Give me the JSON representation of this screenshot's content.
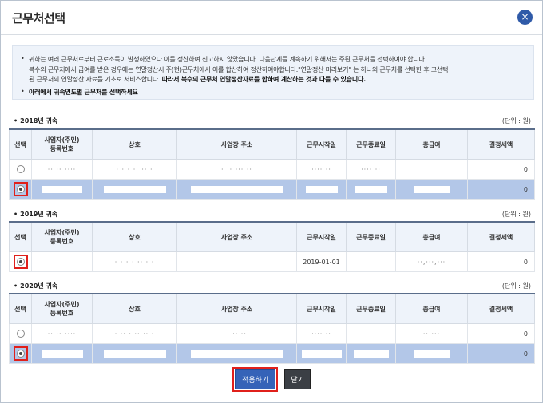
{
  "dialog": {
    "title": "근무처선택",
    "close_icon": "×"
  },
  "notice": {
    "line1": "귀하는 여러 근무처로부터 근로소득이 발생하였으나 이를 정산하여 신고하지 않았습니다. 다음단계를 계속하기 위해서는 주된 근무처를 선택하여야 합니다.",
    "line2": "복수의 근무처에서 급여를 받은 경우에는 연말정산시 주(현)근무처에서 이를 합산하여 정산하여야합니다.\"연말정산 미리보기\" 는 하나의 근무처를 선택한 후 그선택",
    "line3a": "된 근무처의 연말정산 자료를 기초로 서비스합니다.",
    "line3b": "따라서 복수의 근무처 연말정산자료를 합하여 계산하는 것과 다를 수 있습니다.",
    "line4": "아래에서 귀속연도별 근무처를 선택하세요"
  },
  "unit_label": "(단위 : 원)",
  "columns": [
    "선택",
    "사업자(주민)\n등록번호",
    "상호",
    "사업장 주소",
    "근무시작일",
    "근무종료일",
    "총급여",
    "결정세액"
  ],
  "sections": [
    {
      "year_label": "2018년 귀속",
      "rows": [
        {
          "selected": false,
          "start": "",
          "amount": "0"
        },
        {
          "selected": true,
          "start": "",
          "amount": "0"
        }
      ]
    },
    {
      "year_label": "2019년 귀속",
      "rows": [
        {
          "selected": true,
          "start": "2019-01-01",
          "amount": "0"
        }
      ]
    },
    {
      "year_label": "2020년 귀속",
      "rows": [
        {
          "selected": false,
          "start": "",
          "amount": "0"
        },
        {
          "selected": true,
          "start": "",
          "amount": "0"
        }
      ]
    }
  ],
  "buttons": {
    "apply": "적용하기",
    "close": "닫기"
  }
}
